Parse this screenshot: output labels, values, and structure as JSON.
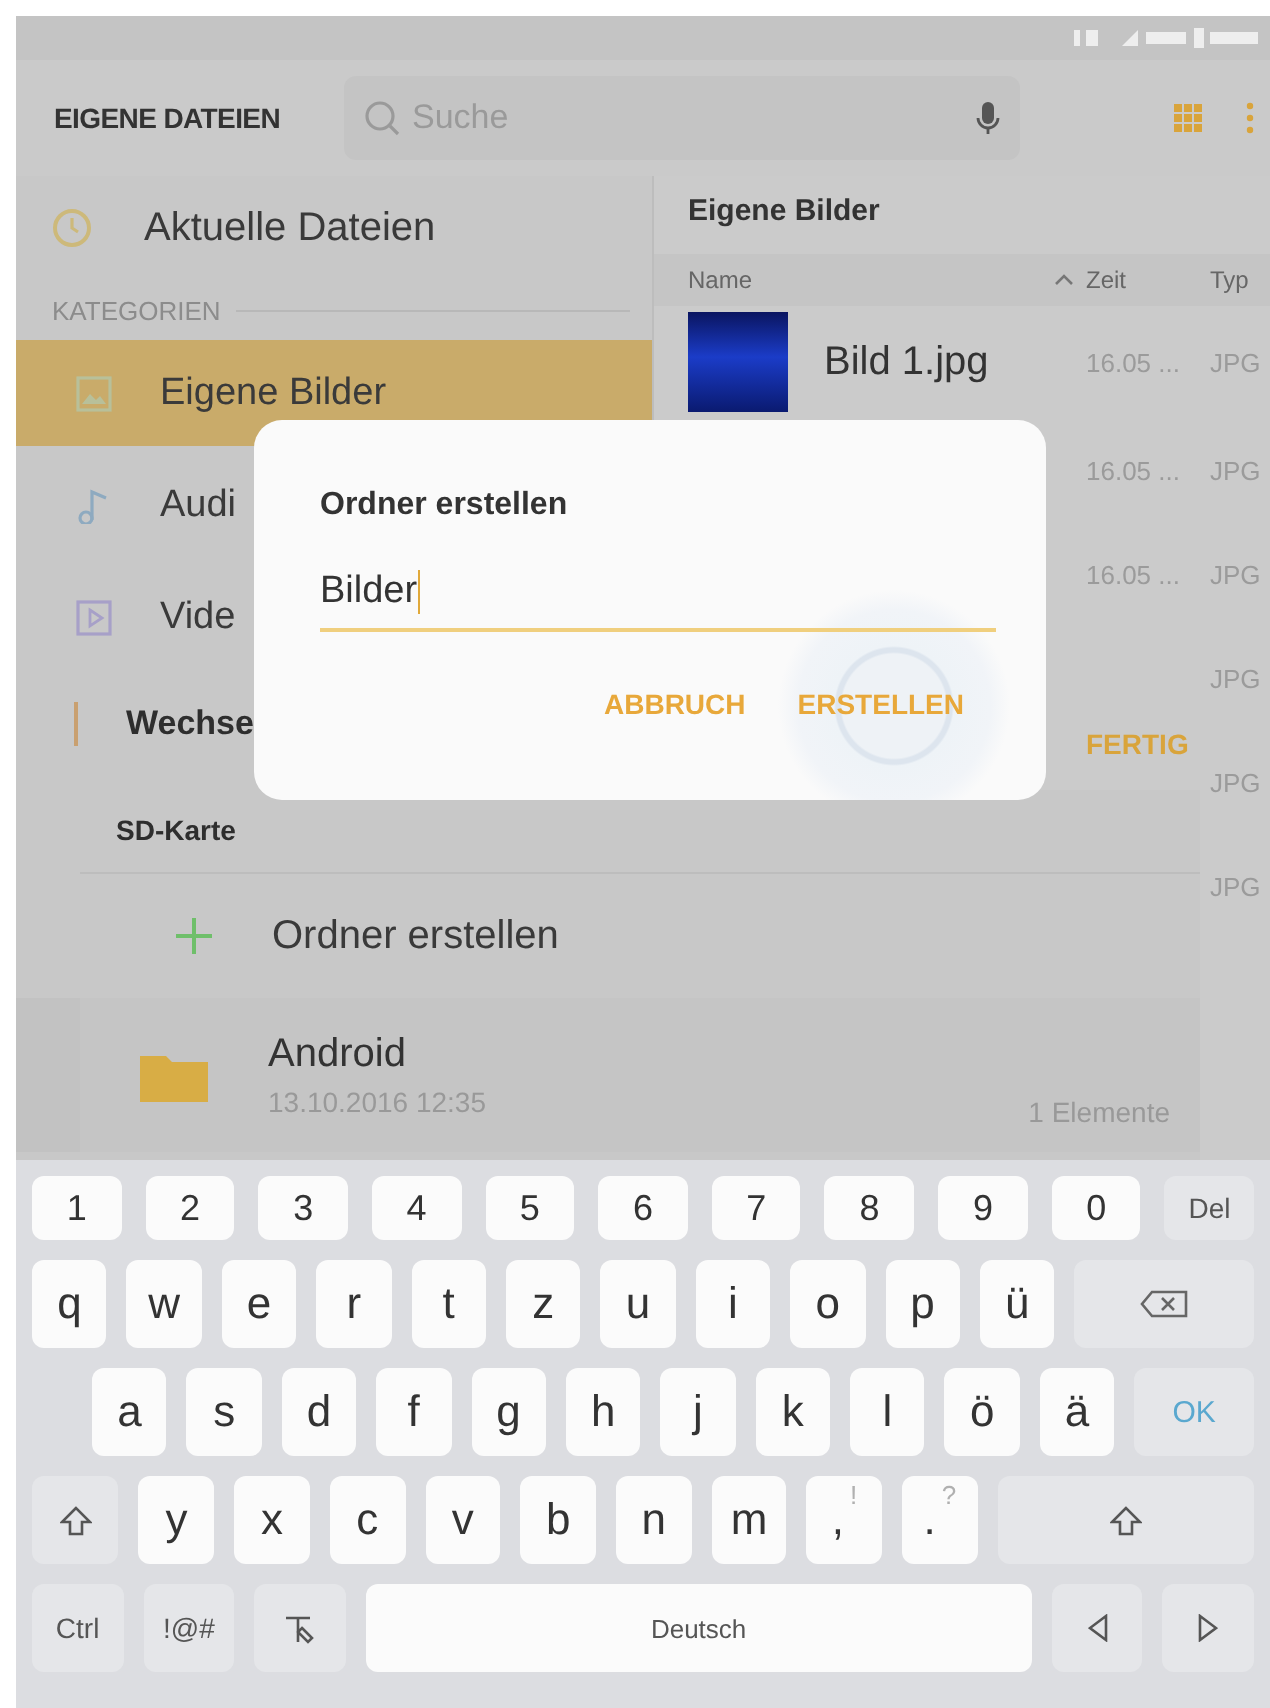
{
  "header": {
    "title": "EIGENE DATEIEN",
    "search": {
      "placeholder": "Suche"
    }
  },
  "sidebar": {
    "recent": "Aktuelle Dateien",
    "section": "KATEGORIEN",
    "items": [
      {
        "label": "Eigene Bilder",
        "kind": "image",
        "selected": true
      },
      {
        "label": "Audi",
        "kind": "audio",
        "selected": false
      },
      {
        "label": "Vide",
        "kind": "video",
        "selected": false
      }
    ],
    "storage_label": "Wechse"
  },
  "file_list": {
    "title": "Eigene Bilder",
    "columns": [
      "Name",
      "Zeit",
      "Typ"
    ],
    "rows": [
      {
        "name": "Bild 1.jpg",
        "time": "16.05 ...",
        "type": "JPG"
      },
      {
        "time": "16.05 ...",
        "type": "JPG"
      },
      {
        "time": "16.05 ...",
        "type": "JPG"
      },
      {
        "type": "JPG"
      },
      {
        "type": "JPG"
      },
      {
        "type": "JPG"
      }
    ],
    "done_button": "FERTIG"
  },
  "storage_panel": {
    "title": "SD-Karte",
    "create_label": "Ordner erstellen",
    "folders": [
      {
        "name": "Android",
        "date": "13.10.2016 12:35",
        "count": "1 Elemente"
      }
    ]
  },
  "dialog": {
    "title": "Ordner erstellen",
    "value": "Bilder",
    "buttons": [
      "ABBRUCH",
      "ERSTELLEN"
    ]
  },
  "keyboard": {
    "rows": [
      {
        "keys": [
          {
            "kind": "char",
            "label": "1"
          },
          {
            "kind": "char",
            "label": "2"
          },
          {
            "kind": "char",
            "label": "3"
          },
          {
            "kind": "char",
            "label": "4"
          },
          {
            "kind": "char",
            "label": "5"
          },
          {
            "kind": "char",
            "label": "6"
          },
          {
            "kind": "char",
            "label": "7"
          },
          {
            "kind": "char",
            "label": "8"
          },
          {
            "kind": "char",
            "label": "9"
          },
          {
            "kind": "char",
            "label": "0"
          },
          {
            "kind": "func",
            "label": "Del"
          }
        ]
      },
      {
        "keys": [
          {
            "kind": "char",
            "label": "q"
          },
          {
            "kind": "char",
            "label": "w"
          },
          {
            "kind": "char",
            "label": "e"
          },
          {
            "kind": "char",
            "label": "r"
          },
          {
            "kind": "char",
            "label": "t"
          },
          {
            "kind": "char",
            "label": "z"
          },
          {
            "kind": "char",
            "label": "u"
          },
          {
            "kind": "char",
            "label": "i"
          },
          {
            "kind": "char",
            "label": "o"
          },
          {
            "kind": "char",
            "label": "p"
          },
          {
            "kind": "char",
            "label": "ü"
          },
          {
            "kind": "backspace"
          }
        ]
      },
      {
        "keys": [
          {
            "kind": "char",
            "label": "a"
          },
          {
            "kind": "char",
            "label": "s"
          },
          {
            "kind": "char",
            "label": "d"
          },
          {
            "kind": "char",
            "label": "f"
          },
          {
            "kind": "char",
            "label": "g"
          },
          {
            "kind": "char",
            "label": "h"
          },
          {
            "kind": "char",
            "label": "j"
          },
          {
            "kind": "char",
            "label": "k"
          },
          {
            "kind": "char",
            "label": "l"
          },
          {
            "kind": "char",
            "label": "ö"
          },
          {
            "kind": "char",
            "label": "ä"
          },
          {
            "kind": "action",
            "label": "OK"
          }
        ]
      },
      {
        "keys": [
          {
            "kind": "shift"
          },
          {
            "kind": "char",
            "label": "y"
          },
          {
            "kind": "char",
            "label": "x"
          },
          {
            "kind": "char",
            "label": "c"
          },
          {
            "kind": "char",
            "label": "v"
          },
          {
            "kind": "char",
            "label": "b"
          },
          {
            "kind": "char",
            "label": "n"
          },
          {
            "kind": "char",
            "label": "m"
          },
          {
            "kind": "char",
            "label": ",",
            "hint": "!"
          },
          {
            "kind": "char",
            "label": ".",
            "hint": "?"
          },
          {
            "kind": "shift"
          }
        ]
      },
      {
        "keys": [
          {
            "kind": "func",
            "label": "Ctrl"
          },
          {
            "kind": "func",
            "label": "!@#"
          },
          {
            "kind": "handwriting"
          },
          {
            "kind": "space",
            "label": "Deutsch"
          },
          {
            "kind": "left"
          },
          {
            "kind": "right"
          }
        ]
      }
    ]
  }
}
